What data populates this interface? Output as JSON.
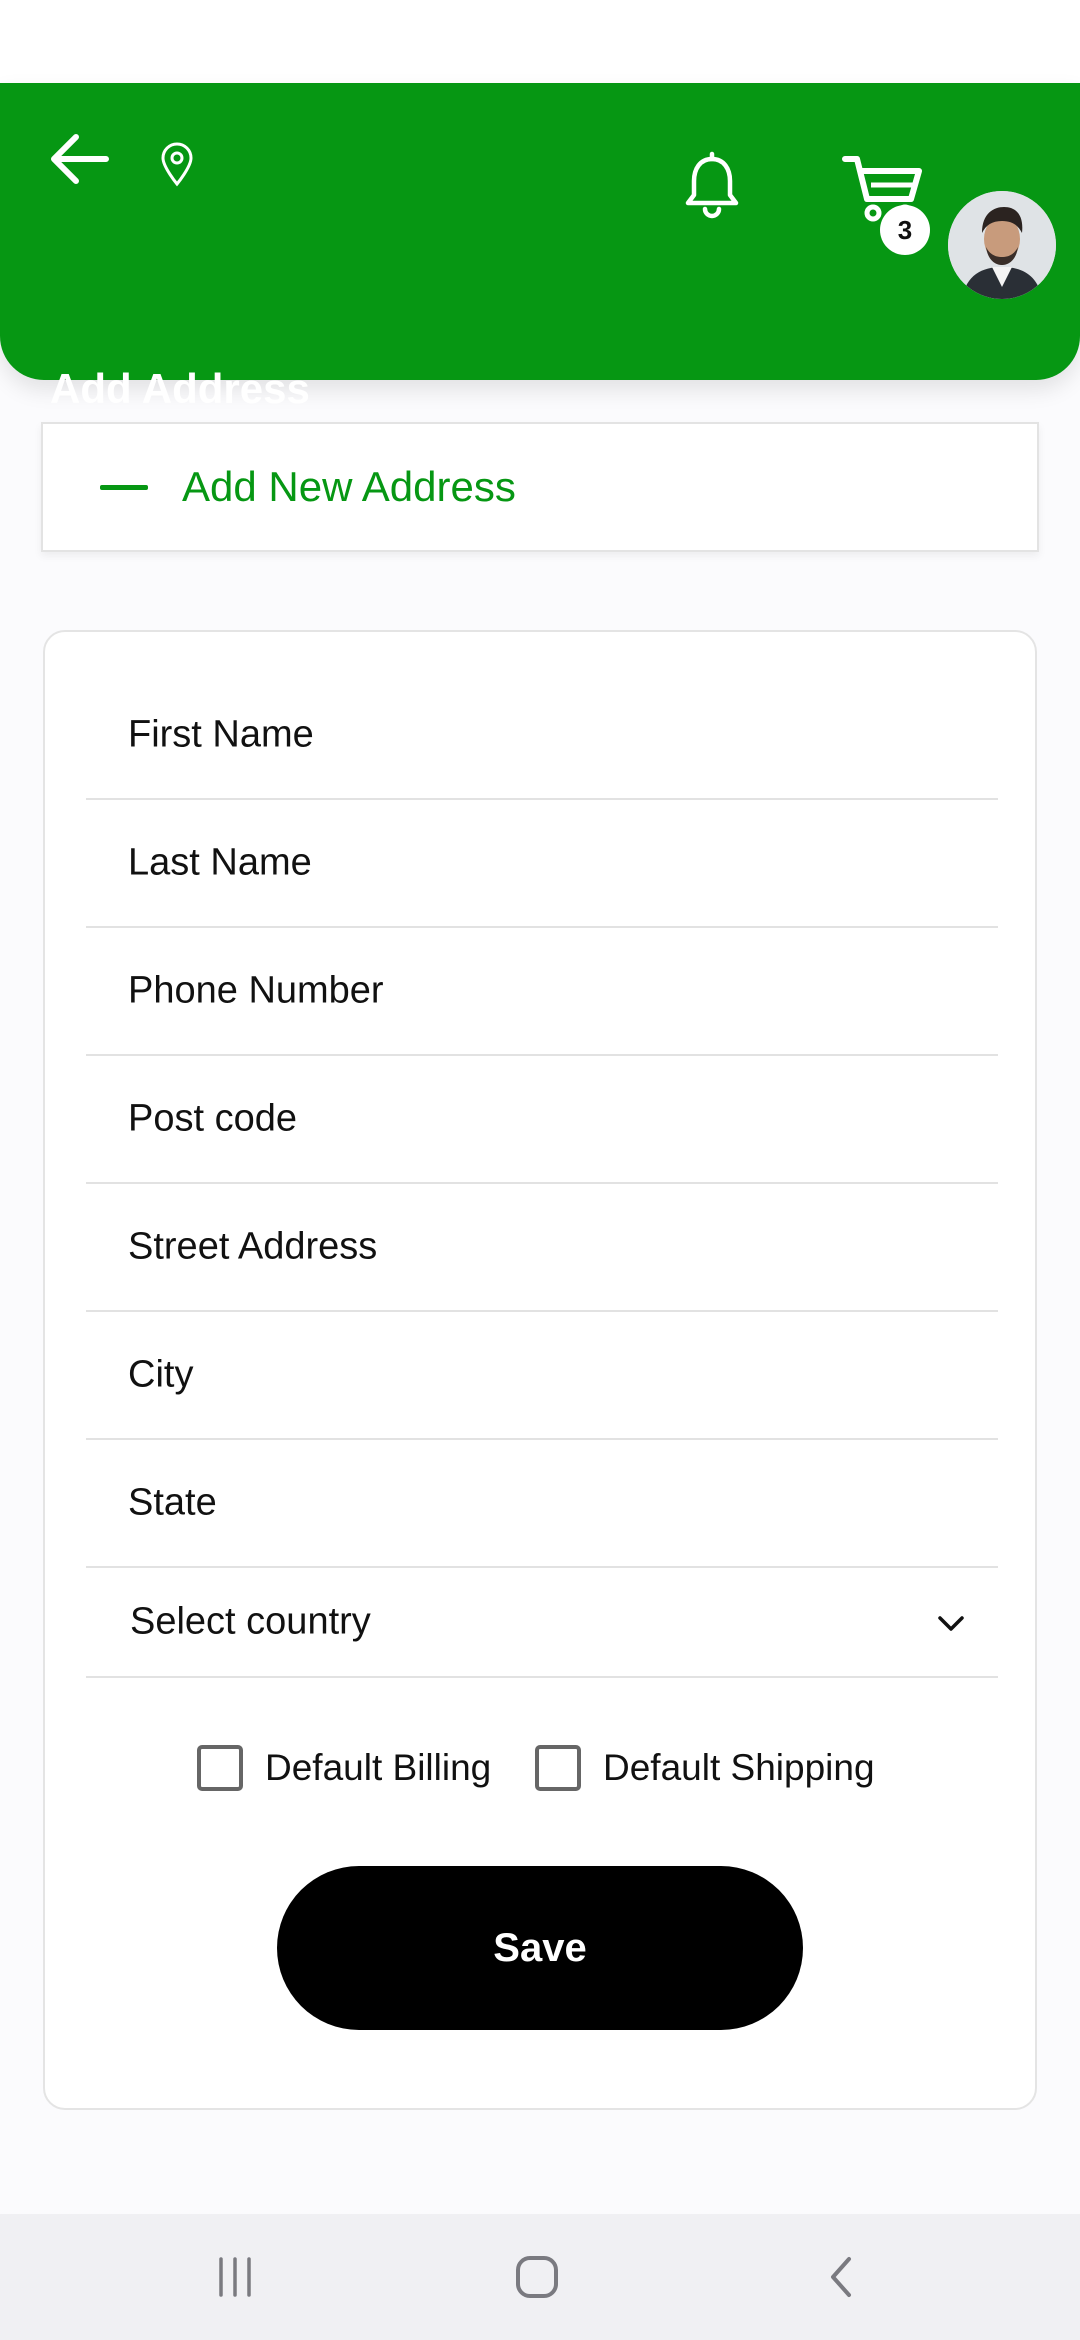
{
  "header": {
    "title": "Add Address",
    "cart_count": "3",
    "icons": {
      "back": "arrow-left-icon",
      "location": "location-pin-icon",
      "notifications": "bell-icon",
      "cart": "cart-icon"
    }
  },
  "add_new": {
    "label": "Add New Address",
    "icon": "minus-icon"
  },
  "form": {
    "fields": [
      {
        "placeholder": "First Name"
      },
      {
        "placeholder": "Last Name"
      },
      {
        "placeholder": "Phone Number"
      },
      {
        "placeholder": "Post code"
      },
      {
        "placeholder": "Street Address"
      },
      {
        "placeholder": "City"
      },
      {
        "placeholder": "State"
      }
    ],
    "country_select": {
      "value": "Select country"
    },
    "checkboxes": {
      "billing": {
        "label": "Default Billing",
        "checked": false
      },
      "shipping": {
        "label": "Default Shipping",
        "checked": false
      }
    },
    "save_label": "Save"
  },
  "navigation": {
    "recent": "recents-icon",
    "home": "home-icon",
    "back": "back-chevron-icon"
  },
  "colors": {
    "brand_green": "#069713",
    "button_black": "#000000",
    "page_bg": "#fbfbfd"
  }
}
